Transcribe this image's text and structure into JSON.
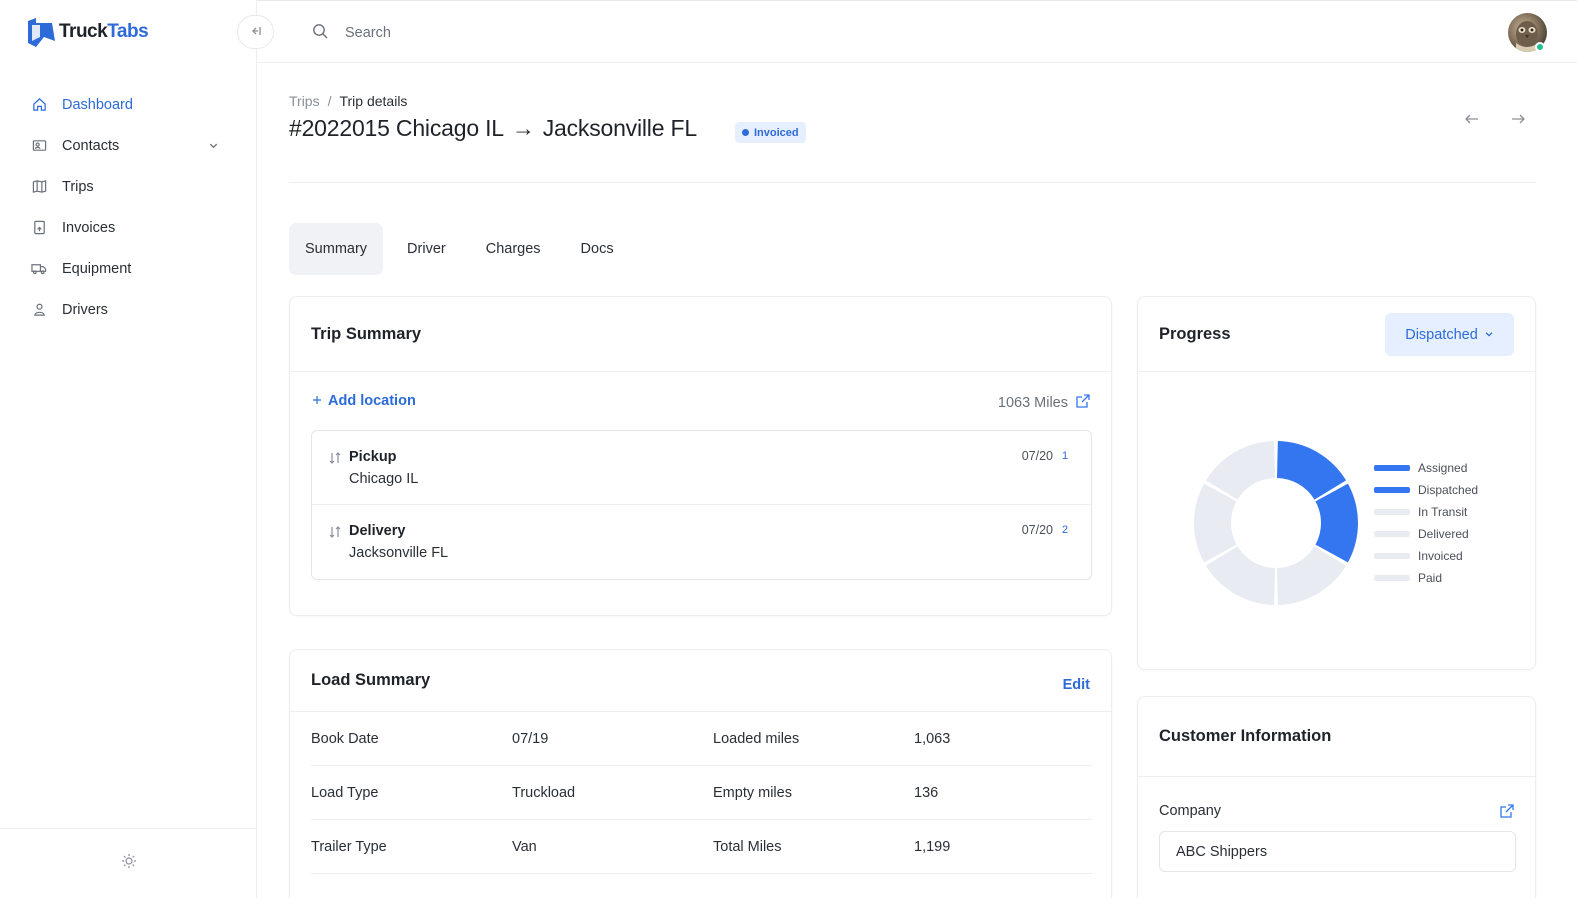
{
  "app": {
    "logo_text_a": "Truck",
    "logo_text_b": "Tabs",
    "collapse_icon": "collapse-left-icon"
  },
  "sidebar": {
    "items": [
      {
        "label": "Dashboard",
        "icon": "home-icon",
        "active": true
      },
      {
        "label": "Contacts",
        "icon": "contact-card-icon",
        "expandable": true
      },
      {
        "label": "Trips",
        "icon": "map-icon"
      },
      {
        "label": "Invoices",
        "icon": "document-icon"
      },
      {
        "label": "Equipment",
        "icon": "truck-icon"
      },
      {
        "label": "Drivers",
        "icon": "user-icon"
      }
    ],
    "footer_icon": "sun-icon"
  },
  "topbar": {
    "search_placeholder": "Search",
    "search_value": ""
  },
  "breadcrumb": {
    "parent": "Trips",
    "separator": "/",
    "current": "Trip details"
  },
  "trip": {
    "title_prefix": "#2022015 Chicago IL",
    "title_arrow": "→",
    "title_suffix": "Jacksonville FL",
    "status": "Invoiced"
  },
  "tabs": [
    {
      "label": "Summary",
      "active": true
    },
    {
      "label": "Driver"
    },
    {
      "label": "Charges"
    },
    {
      "label": "Docs"
    }
  ],
  "trip_summary": {
    "title": "Trip Summary",
    "add_location": "Add location",
    "miles": "1063 Miles",
    "stops": [
      {
        "type": "Pickup",
        "city": "Chicago IL",
        "date": "07/20",
        "num": "1"
      },
      {
        "type": "Delivery",
        "city": "Jacksonville FL",
        "date": "07/20",
        "num": "2"
      }
    ]
  },
  "load_summary": {
    "title": "Load Summary",
    "edit": "Edit",
    "rows": [
      {
        "k1": "Book Date",
        "v1": "07/19",
        "k2": "Loaded miles",
        "v2": "1,063"
      },
      {
        "k1": "Load Type",
        "v1": "Truckload",
        "k2": "Empty miles",
        "v2": "136"
      },
      {
        "k1": "Trailer Type",
        "v1": "Van",
        "k2": "Total Miles",
        "v2": "1,199"
      }
    ]
  },
  "progress": {
    "title": "Progress",
    "selected": "Dispatched",
    "stages": [
      "Assigned",
      "Dispatched",
      "In Transit",
      "Delivered",
      "Invoiced",
      "Paid"
    ],
    "completed": 2,
    "active_color": "#3476f0",
    "inactive_color": "#e8ebf2"
  },
  "customer": {
    "title": "Customer Information",
    "company_label": "Company",
    "company_value": "ABC Shippers"
  }
}
